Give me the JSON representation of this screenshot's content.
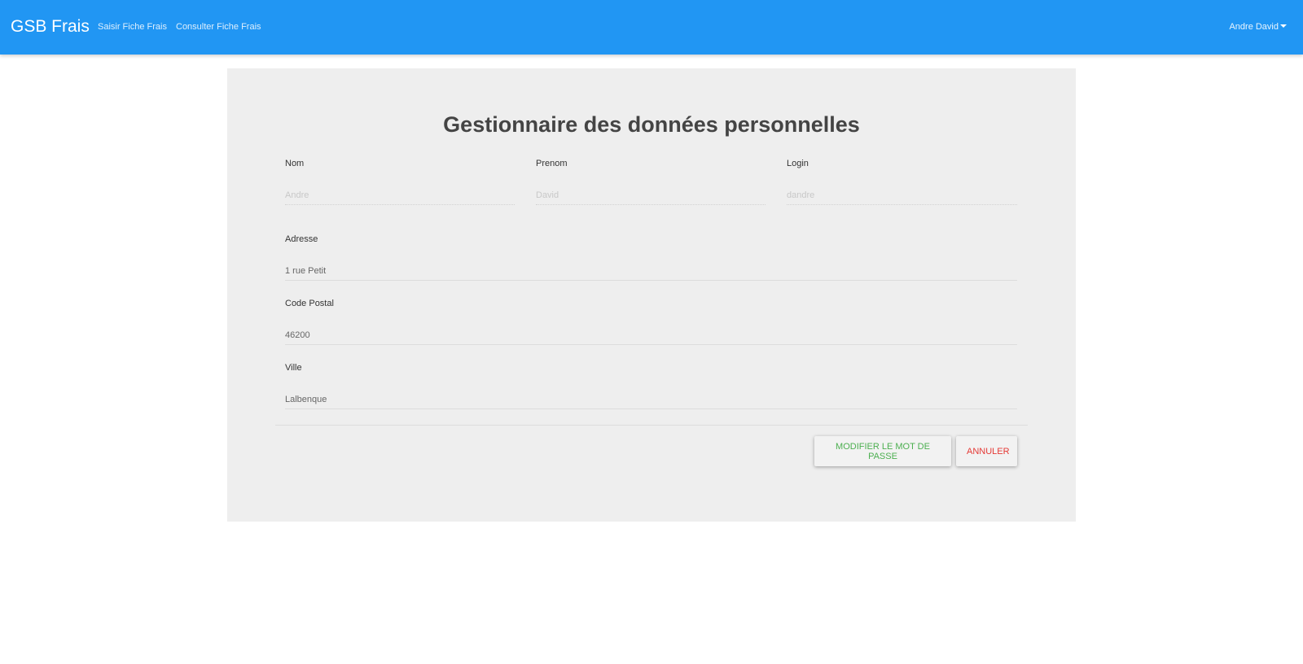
{
  "navbar": {
    "brand": "GSB Frais",
    "links": [
      {
        "label": "Saisir Fiche Frais"
      },
      {
        "label": "Consulter Fiche Frais"
      }
    ],
    "user": "Andre David",
    "color": "#2196f3"
  },
  "page": {
    "title": "Gestionnaire des données personnelles"
  },
  "form": {
    "nom": {
      "label": "Nom",
      "value": "Andre"
    },
    "prenom": {
      "label": "Prenom",
      "value": "David"
    },
    "login": {
      "label": "Login",
      "value": "dandre"
    },
    "adresse": {
      "label": "Adresse",
      "value": "1 rue Petit"
    },
    "code_postal": {
      "label": "Code Postal",
      "value": "46200"
    },
    "ville": {
      "label": "Ville",
      "value": "Lalbenque"
    }
  },
  "actions": {
    "change_password": "Modifier le mot de passe",
    "cancel": "Annuler"
  }
}
